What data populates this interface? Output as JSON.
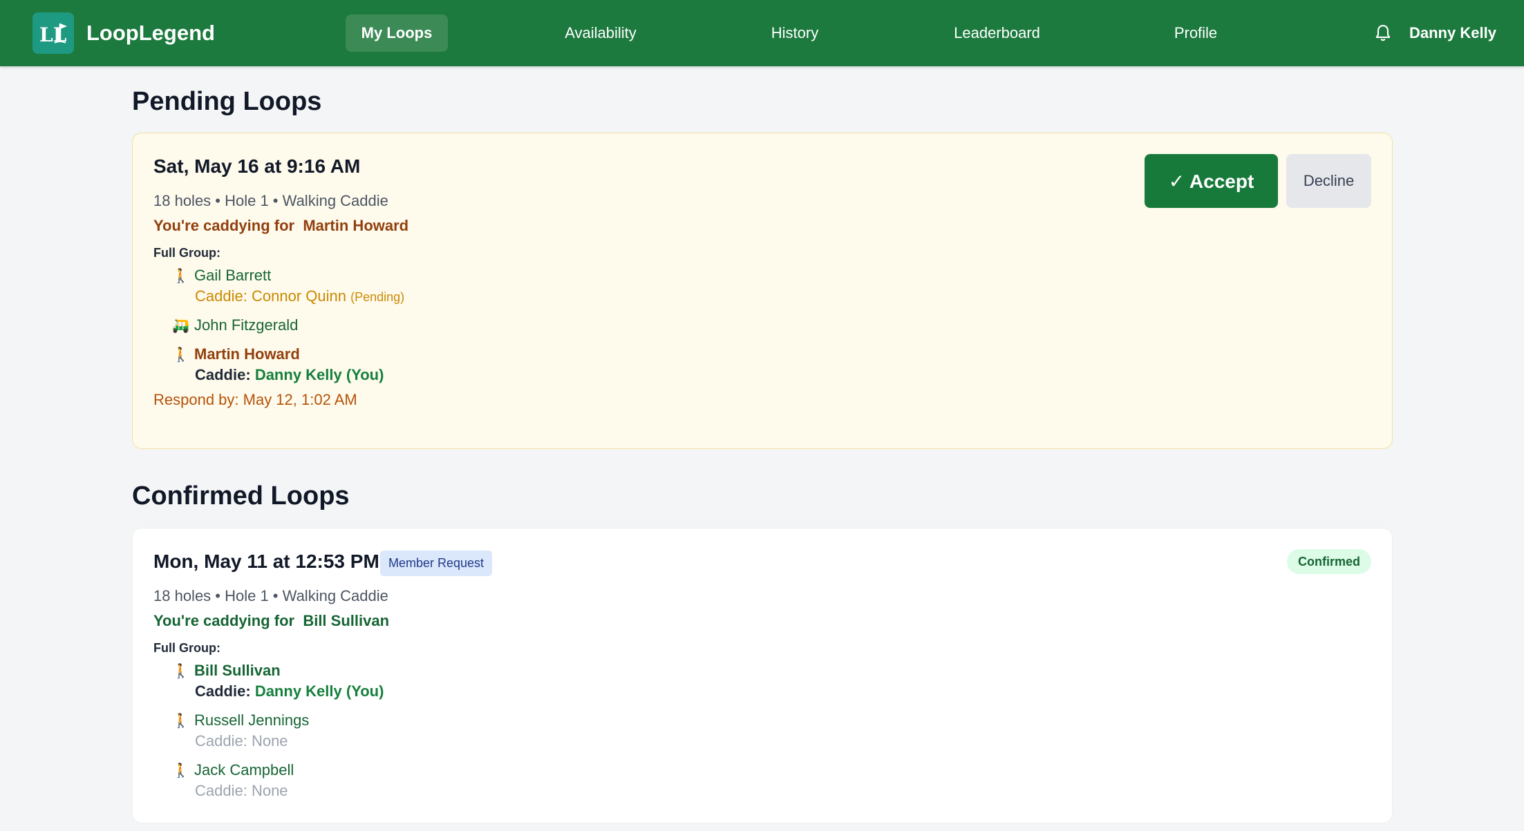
{
  "nav": {
    "brand_name": "LoopLegend",
    "brand_logo_text": "LL",
    "items": [
      {
        "label": "My Loops",
        "active": true
      },
      {
        "label": "Availability",
        "active": false
      },
      {
        "label": "History",
        "active": false
      },
      {
        "label": "Leaderboard",
        "active": false
      },
      {
        "label": "Profile",
        "active": false
      }
    ],
    "user_name": "Danny Kelly",
    "notification_icon": "bell-icon"
  },
  "pending": {
    "section_title": "Pending Loops",
    "loop": {
      "date": "Sat, May 16 at 9:16 AM",
      "meta": "18 holes • Hole 1 • Walking Caddie",
      "caddying_for_prefix": "You're caddying for",
      "caddying_for_name": "Martin Howard",
      "group_label": "Full Group:",
      "players": [
        {
          "icon": "🚶",
          "icon_name": "walking-icon",
          "name": "Gail Barrett",
          "caddie_prefix": "Caddie:",
          "caddie_name": "Connor Quinn",
          "caddie_tag": "(Pending)"
        },
        {
          "icon": "🛺",
          "icon_name": "golf-cart-icon",
          "name": "John Fitzgerald"
        },
        {
          "icon": "🚶",
          "icon_name": "walking-icon",
          "name": "Martin Howard",
          "caddie_prefix": "Caddie:",
          "caddie_name": "Danny Kelly",
          "caddie_tag": "(You)"
        }
      ],
      "respond_by": "Respond by: May 12, 1:02 AM",
      "accept_label": "✓ Accept",
      "decline_label": "Decline"
    }
  },
  "confirmed": {
    "section_title": "Confirmed Loops",
    "loop": {
      "date": "Mon, May 11 at 12:53 PM",
      "badge": "Member Request",
      "status": "Confirmed",
      "meta": "18 holes • Hole 1 • Walking Caddie",
      "caddying_for_prefix": "You're caddying for",
      "caddying_for_name": "Bill Sullivan",
      "group_label": "Full Group:",
      "players": [
        {
          "icon": "🚶",
          "icon_name": "walking-icon",
          "name": "Bill Sullivan",
          "caddie_prefix": "Caddie:",
          "caddie_name": "Danny Kelly",
          "caddie_tag": "(You)"
        },
        {
          "icon": "🚶",
          "icon_name": "walking-icon",
          "name": "Russell Jennings",
          "caddie_text": "Caddie: None"
        },
        {
          "icon": "🚶",
          "icon_name": "walking-icon",
          "name": "Jack Campbell",
          "caddie_text": "Caddie: None"
        }
      ]
    }
  },
  "colors": {
    "nav_bg": "#1c7a3e",
    "accent_green": "#177a3a",
    "pending_card_bg": "#fefaec",
    "pending_text": "#92400e",
    "respond_text": "#b45309"
  }
}
